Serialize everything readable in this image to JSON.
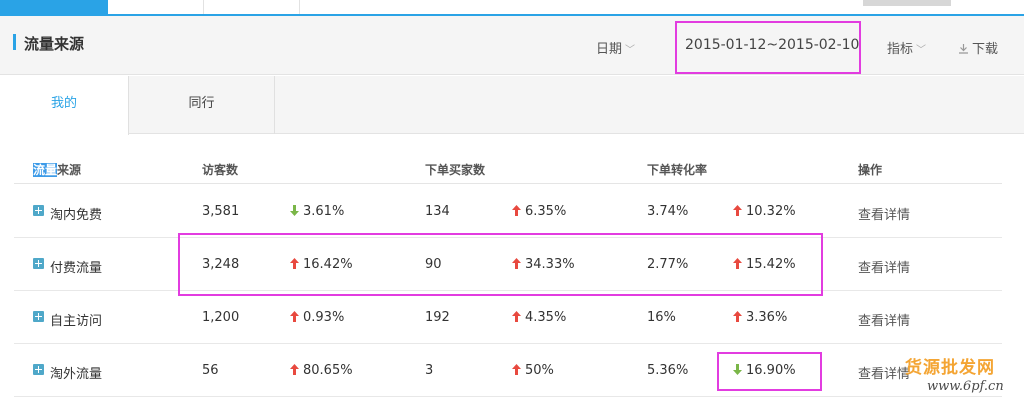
{
  "header": {
    "title": "流量来源",
    "date_label": "日期",
    "date_range": "2015-01-12~2015-02-10",
    "metric_label": "指标",
    "download_label": "下载"
  },
  "subtabs": [
    {
      "label": "我的"
    },
    {
      "label": "同行"
    }
  ],
  "table": {
    "headers": {
      "source_highlight": "流量",
      "source_rest": "来源",
      "visitors": "访客数",
      "buyers": "下单买家数",
      "conversion": "下单转化率",
      "action": "操作"
    },
    "rows": [
      {
        "source": "淘内免费",
        "visitors": "3,581",
        "visitors_change": "3.61%",
        "visitors_dir": "down",
        "buyers": "134",
        "buyers_change": "6.35%",
        "buyers_dir": "up",
        "conversion": "3.74%",
        "conversion_change": "10.32%",
        "conversion_dir": "up",
        "action": "查看详情"
      },
      {
        "source": "付费流量",
        "visitors": "3,248",
        "visitors_change": "16.42%",
        "visitors_dir": "up",
        "buyers": "90",
        "buyers_change": "34.33%",
        "buyers_dir": "up",
        "conversion": "2.77%",
        "conversion_change": "15.42%",
        "conversion_dir": "up",
        "action": "查看详情"
      },
      {
        "source": "自主访问",
        "visitors": "1,200",
        "visitors_change": "0.93%",
        "visitors_dir": "up",
        "buyers": "192",
        "buyers_change": "4.35%",
        "buyers_dir": "up",
        "conversion": "16%",
        "conversion_change": "3.36%",
        "conversion_dir": "up",
        "action": "查看详情"
      },
      {
        "source": "淘外流量",
        "visitors": "56",
        "visitors_change": "80.65%",
        "visitors_dir": "up",
        "buyers": "3",
        "buyers_change": "50%",
        "buyers_dir": "up",
        "conversion": "5.36%",
        "conversion_change": "16.90%",
        "conversion_dir": "down",
        "action": "查看详情"
      }
    ]
  },
  "colors": {
    "accent": "#2aa3e6",
    "arrow_up": "#e8493f",
    "arrow_down": "#7ab648",
    "highlight_box": "#e23ce0",
    "watermark": "#f4a534"
  },
  "icons": {
    "expand": "plus-square-icon",
    "up": "arrow-up-icon",
    "down": "arrow-down-icon",
    "dropdown": "chevron-down-icon",
    "download": "download-icon"
  },
  "watermark": {
    "cn": "货源批发网",
    "url": "www.6pf.cn"
  }
}
